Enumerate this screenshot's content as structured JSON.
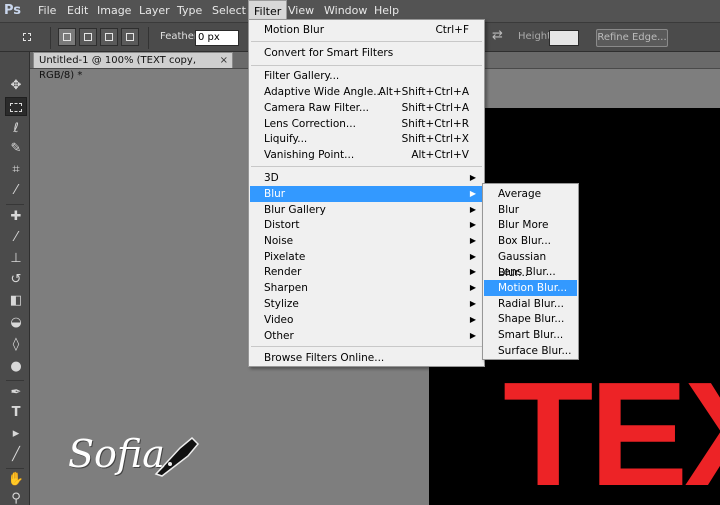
{
  "app": {
    "logo": "Ps"
  },
  "menubar": {
    "items": [
      "File",
      "Edit",
      "Image",
      "Layer",
      "Type",
      "Select",
      "Filter",
      "View",
      "Window",
      "Help"
    ],
    "active": "Filter"
  },
  "options": {
    "feather_label": "Feather:",
    "feather_value": "0 px",
    "height_label": "Height:",
    "height_value": "",
    "refine_edge": "Refine Edge..."
  },
  "document": {
    "tab_title": "Untitled-1 @ 100% (TEXT copy, RGB/8) *",
    "tab_close": "×",
    "canvas_text": "TEX"
  },
  "watermark": {
    "text": "Sofia"
  },
  "filter_menu": {
    "top_items": [
      {
        "label": "Motion Blur",
        "shortcut": "Ctrl+F"
      },
      {
        "label": "Convert for Smart Filters",
        "shortcut": ""
      },
      {
        "label": "Filter Gallery...",
        "shortcut": ""
      },
      {
        "label": "Adaptive Wide Angle...",
        "shortcut": "Alt+Shift+Ctrl+A"
      },
      {
        "label": "Camera Raw Filter...",
        "shortcut": "Shift+Ctrl+A"
      },
      {
        "label": "Lens Correction...",
        "shortcut": "Shift+Ctrl+R"
      },
      {
        "label": "Liquify...",
        "shortcut": "Shift+Ctrl+X"
      },
      {
        "label": "Vanishing Point...",
        "shortcut": "Alt+Ctrl+V"
      }
    ],
    "submenus": [
      "3D",
      "Blur",
      "Blur Gallery",
      "Distort",
      "Noise",
      "Pixelate",
      "Render",
      "Sharpen",
      "Stylize",
      "Video",
      "Other"
    ],
    "highlighted": "Blur",
    "browse": "Browse Filters Online..."
  },
  "blur_menu": {
    "items": [
      "Average",
      "Blur",
      "Blur More",
      "Box Blur...",
      "Gaussian Blur...",
      "Lens Blur...",
      "Motion Blur...",
      "Radial Blur...",
      "Shape Blur...",
      "Smart Blur...",
      "Surface Blur..."
    ],
    "highlighted": "Motion Blur..."
  },
  "colors": {
    "highlight": "#3399ff",
    "canvas_text": "#ed2326"
  },
  "icons": [
    "move-tool-icon",
    "marquee-tool-icon",
    "lasso-tool-icon",
    "quick-select-icon",
    "crop-tool-icon",
    "eyedropper-icon",
    "healing-brush-icon",
    "brush-tool-icon",
    "clone-stamp-icon",
    "history-brush-icon",
    "eraser-icon",
    "paint-bucket-icon",
    "blur-tool-icon",
    "dodge-tool-icon",
    "pen-tool-icon",
    "type-tool-icon",
    "path-select-icon",
    "line-tool-icon",
    "hand-tool-icon",
    "zoom-tool-icon"
  ]
}
